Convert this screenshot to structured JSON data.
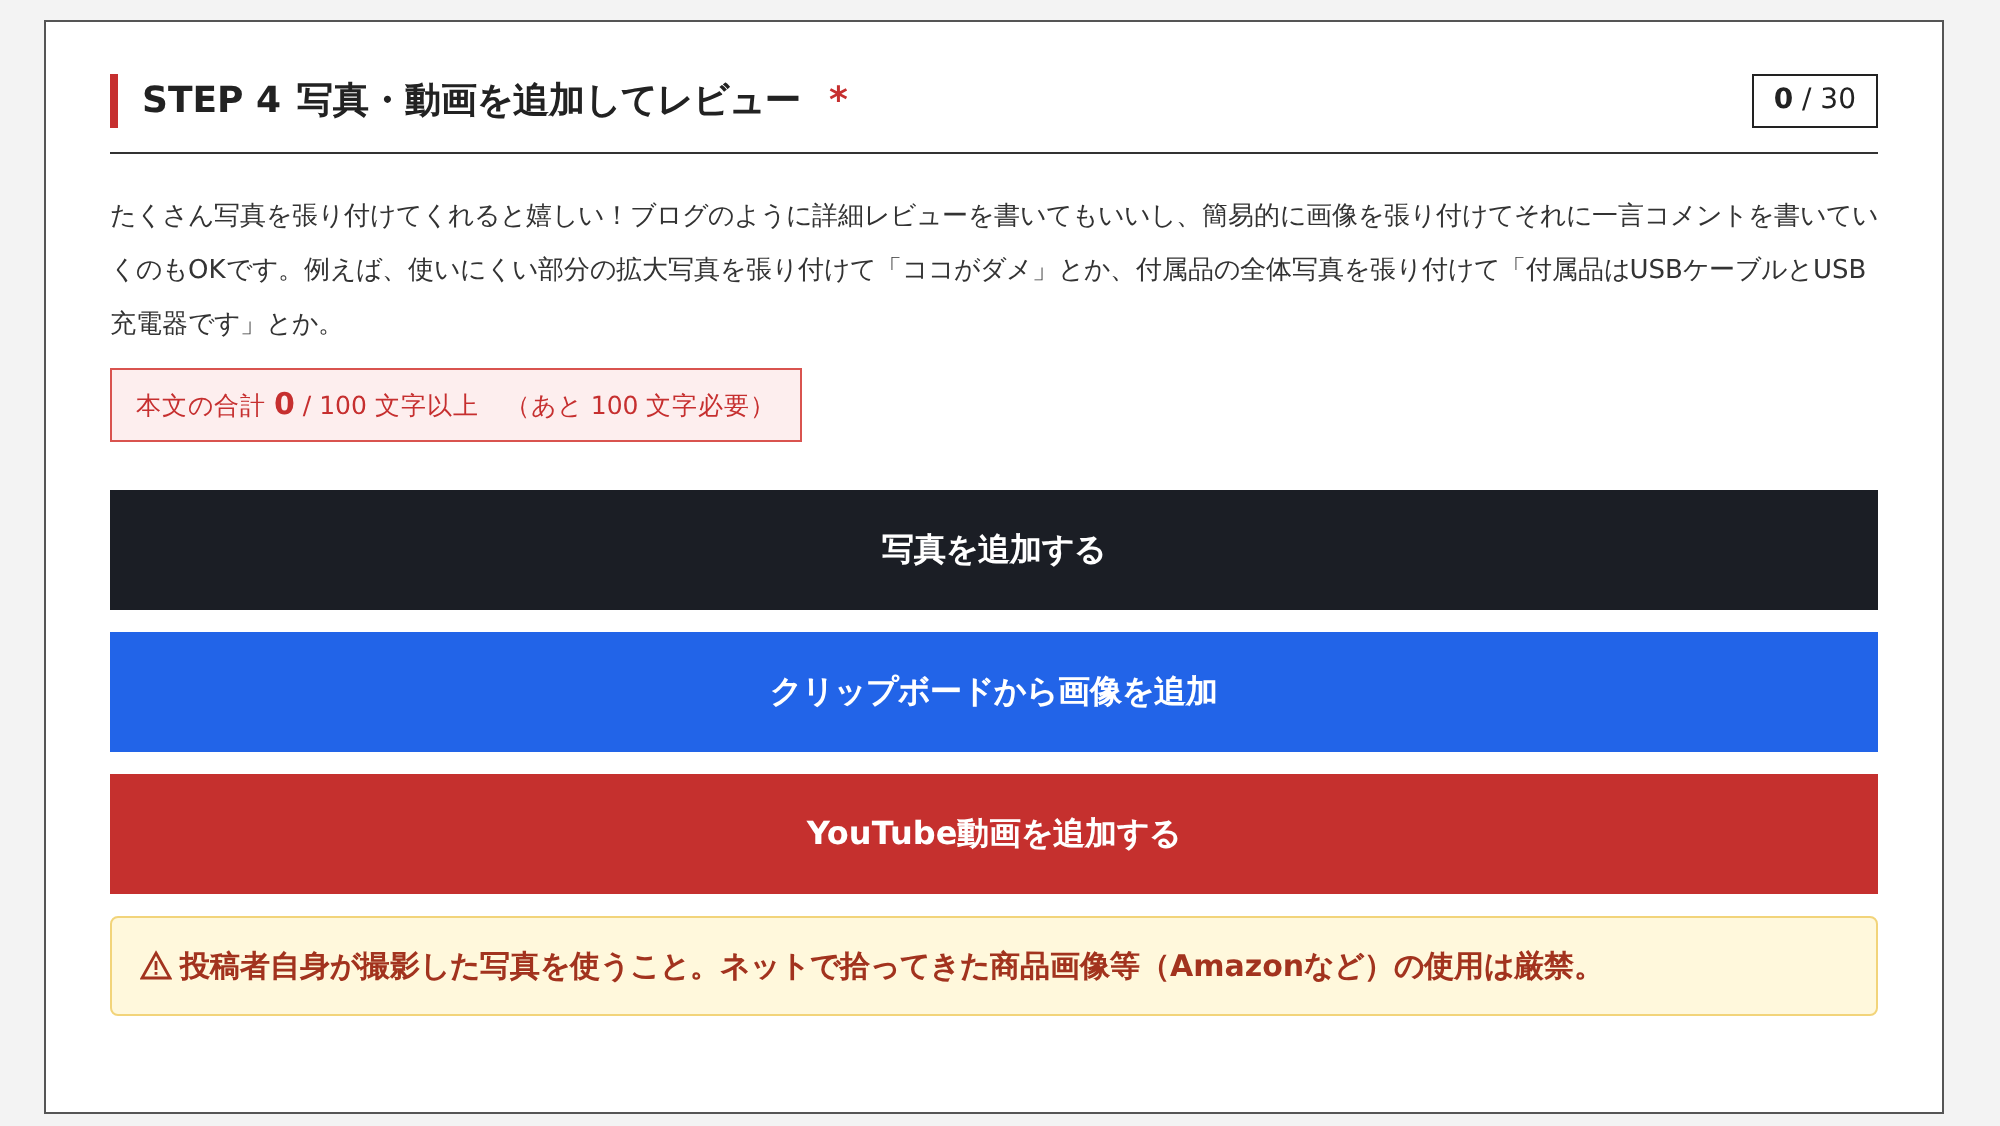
{
  "header": {
    "step": "STEP 4",
    "title": "写真・動画を追加してレビュー",
    "required_mark": "*",
    "count": "**0** / 30"
  },
  "description": "たくさん写真を張り付けてくれると嬉しい！ブログのように詳細レビューを書いてもいいし、簡易的に画像を張り付けてそれに一言コメントを書いていくのもOKです。例えば、使いにくい部分の拡大写真を張り付けて「ココがダメ」とか、付属品の全体写真を張り付けて「付属品はUSBケーブルとUSB充電器です」とか。",
  "char_counter": "本文の合計 **0** / 100 文字以上　（あと 100 文字必要）",
  "buttons": [
    {
      "label": "写真を追加する",
      "kind": "dark"
    },
    {
      "label": "クリップボードから画像を追加",
      "kind": "primary"
    },
    {
      "label": "YouTube動画を追加する",
      "kind": "danger"
    }
  ],
  "warning": "投稿者自身が撮影した写真を使うこと。ネットで拾ってきた商品画像等（Amazonなど）の使用は厳禁。"
}
